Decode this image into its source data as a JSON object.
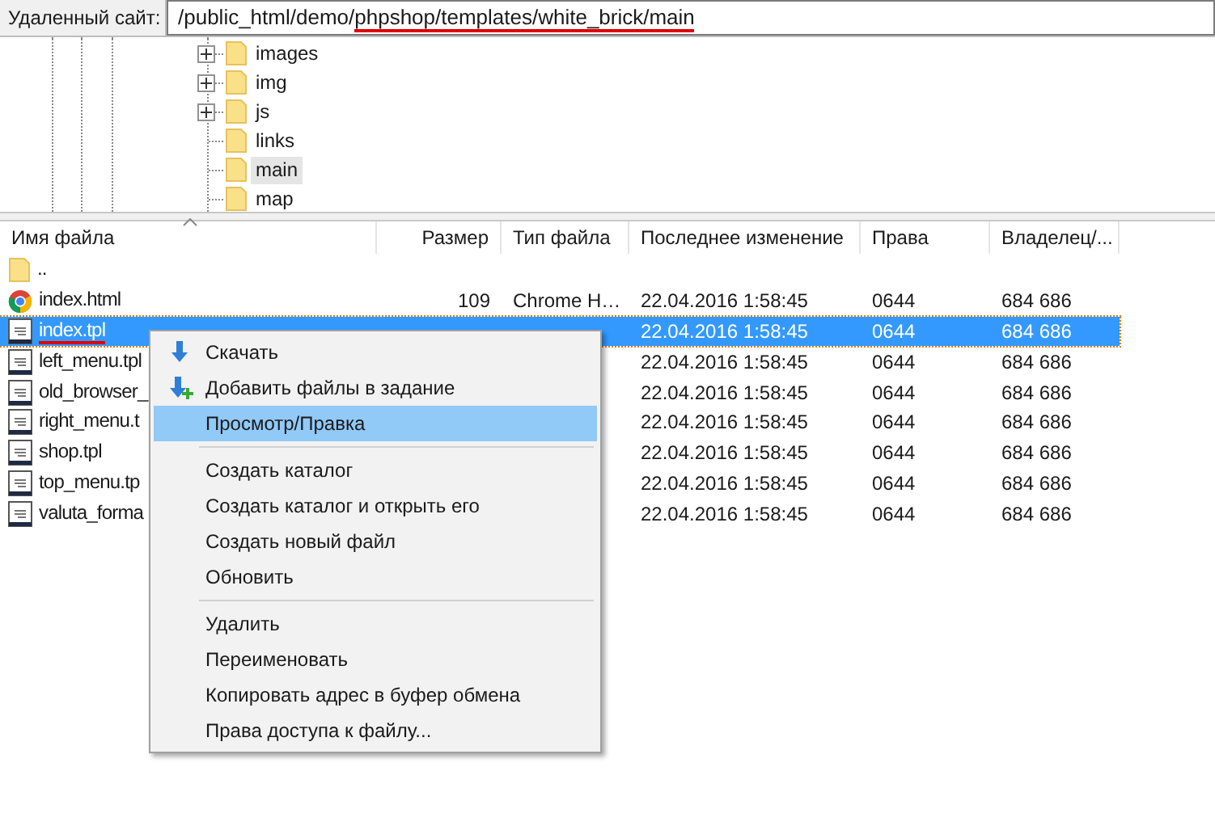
{
  "remote_site": {
    "label": "Удаленный сайт:",
    "path": [
      {
        "text": "/public_html/demo/",
        "underlined": false
      },
      {
        "text": "phpshop/templates/white_brick/main",
        "underlined": true
      }
    ]
  },
  "tree": [
    {
      "label": "images",
      "expandable": true,
      "selected": false
    },
    {
      "label": "img",
      "expandable": true,
      "selected": false
    },
    {
      "label": "js",
      "expandable": true,
      "selected": false
    },
    {
      "label": "links",
      "expandable": false,
      "selected": false
    },
    {
      "label": "main",
      "expandable": false,
      "selected": true
    },
    {
      "label": "map",
      "expandable": false,
      "selected": false
    }
  ],
  "file_list": {
    "columns": [
      {
        "label": "Имя файла",
        "sorted": true
      },
      {
        "label": "Размер",
        "sorted": false
      },
      {
        "label": "Тип файла",
        "sorted": false
      },
      {
        "label": "Последнее изменение",
        "sorted": false
      },
      {
        "label": "Права",
        "sorted": false
      },
      {
        "label": "Владелец/...",
        "sorted": false
      }
    ],
    "rows": [
      {
        "kind": "folder",
        "name": "..",
        "selected": false,
        "underlined": false
      },
      {
        "kind": "chrome",
        "name": "index.html",
        "size": "109",
        "type": "Chrome H…",
        "modified": "22.04.2016 1:58:45",
        "permissions": "0644",
        "owner": "684 686",
        "selected": false,
        "underlined": false
      },
      {
        "kind": "text",
        "name": "index.tpl",
        "modified": "22.04.2016 1:58:45",
        "permissions": "0644",
        "owner": "684 686",
        "selected": true,
        "underlined": true
      },
      {
        "kind": "text",
        "name": "left_menu.tpl",
        "modified": "22.04.2016 1:58:45",
        "permissions": "0644",
        "owner": "684 686",
        "selected": false,
        "underlined": false
      },
      {
        "kind": "text",
        "name": "old_browser_",
        "modified": "22.04.2016 1:58:45",
        "permissions": "0644",
        "owner": "684 686",
        "selected": false,
        "underlined": false
      },
      {
        "kind": "text",
        "name": "right_menu.t",
        "modified": "22.04.2016 1:58:45",
        "permissions": "0644",
        "owner": "684 686",
        "selected": false,
        "underlined": false
      },
      {
        "kind": "text",
        "name": "shop.tpl",
        "modified": "22.04.2016 1:58:45",
        "permissions": "0644",
        "owner": "684 686",
        "selected": false,
        "underlined": false
      },
      {
        "kind": "text",
        "name": "top_menu.tp",
        "modified": "22.04.2016 1:58:45",
        "permissions": "0644",
        "owner": "684 686",
        "selected": false,
        "underlined": false
      },
      {
        "kind": "text",
        "name": "valuta_forma",
        "modified": "22.04.2016 1:58:45",
        "permissions": "0644",
        "owner": "684 686",
        "selected": false,
        "underlined": false
      }
    ]
  },
  "context_menu": [
    {
      "kind": "download",
      "label": "Скачать",
      "selected": false
    },
    {
      "kind": "add",
      "label": "Добавить файлы в задание",
      "selected": false
    },
    {
      "kind": "item",
      "label": "Просмотр/Правка",
      "selected": true
    },
    {
      "kind": "separator"
    },
    {
      "kind": "item",
      "label": "Создать каталог",
      "selected": false
    },
    {
      "kind": "item",
      "label": "Создать каталог и открыть его",
      "selected": false
    },
    {
      "kind": "item",
      "label": "Создать новый файл",
      "selected": false
    },
    {
      "kind": "item",
      "label": "Обновить",
      "selected": false
    },
    {
      "kind": "separator"
    },
    {
      "kind": "item",
      "label": "Удалить",
      "selected": false
    },
    {
      "kind": "item",
      "label": "Переименовать",
      "selected": false
    },
    {
      "kind": "item",
      "label": "Копировать адрес в буфер обмена",
      "selected": false
    },
    {
      "kind": "item",
      "label": "Права доступа к файлу...",
      "selected": false
    }
  ]
}
